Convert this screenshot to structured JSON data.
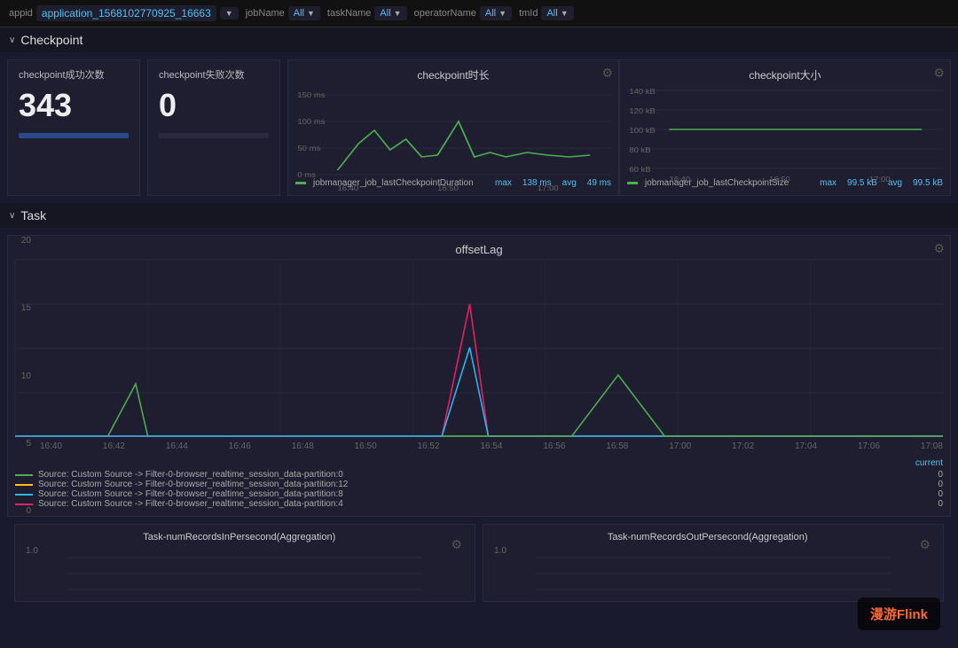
{
  "topbar": {
    "appid_label": "appid",
    "appid_value": "application_1568102770925_16663",
    "jobname_label": "jobName",
    "jobname_value": "All",
    "taskname_label": "taskName",
    "taskname_value": "All",
    "operatorname_label": "operatorName",
    "operatorname_value": "All",
    "tmid_label": "tmId",
    "tmid_value": "All"
  },
  "checkpoint_section": {
    "chevron": "∨",
    "title": "Checkpoint",
    "success_card": {
      "title": "checkpoint成功次数",
      "value": "343"
    },
    "fail_card": {
      "title": "checkpoint失败次数",
      "value": "0"
    },
    "duration_chart": {
      "title": "checkpoint时长",
      "legend_label": "jobmanager_job_lastCheckpointDuration",
      "max_label": "max",
      "avg_label": "avg",
      "max_value": "138 ms",
      "avg_value": "49 ms",
      "y_labels": [
        "150 ms",
        "100 ms",
        "50 ms",
        "0 ms"
      ],
      "x_labels": [
        "16:40",
        "16:50",
        "17:00"
      ]
    },
    "size_chart": {
      "title": "checkpoint大小",
      "legend_label": "jobmanager_job_lastCheckpointSize",
      "max_label": "max",
      "avg_label": "avg",
      "max_value": "99.5 kB",
      "avg_value": "99.5 kB",
      "y_labels": [
        "140 kB",
        "120 kB",
        "100 kB",
        "80 kB",
        "60 kB"
      ],
      "x_labels": [
        "16:40",
        "16:50",
        "17:00"
      ]
    }
  },
  "task_section": {
    "chevron": "∨",
    "title": "Task",
    "offsetlag": {
      "title": "offsetLag",
      "y_labels": [
        "20",
        "15",
        "10",
        "5",
        "0"
      ],
      "x_labels": [
        "16:40",
        "16:42",
        "16:44",
        "16:46",
        "16:48",
        "16:50",
        "16:52",
        "16:54",
        "16:56",
        "16:58",
        "17:00",
        "17:02",
        "17:04",
        "17:06",
        "17:08"
      ],
      "current_label": "current",
      "legend_items": [
        {
          "color": "#4caf50",
          "label": "Source: Custom Source -> Filter-0-browser_realtime_session_data-partition:0",
          "current": "0"
        },
        {
          "color": "#ffc107",
          "label": "Source: Custom Source -> Filter-0-browser_realtime_session_data-partition:12",
          "current": "0"
        },
        {
          "color": "#29b6f6",
          "label": "Source: Custom Source -> Filter-0-browser_realtime_session_data-partition:8",
          "current": "0"
        },
        {
          "color": "#e91e63",
          "label": "Source: Custom Source -> Filter-0-browser_realtime_session_data-partition:4",
          "current": "0"
        }
      ]
    }
  },
  "bottom_charts": {
    "left_title": "Task-numRecordsInPersecond(Aggregation)",
    "left_y": "1.0",
    "right_title": "Task-numRecordsOutPersecond(Aggregation)",
    "right_y": "1.0",
    "gear_icon": "⚙"
  },
  "watermark": {
    "text": "漫游",
    "brand": "Flink"
  }
}
